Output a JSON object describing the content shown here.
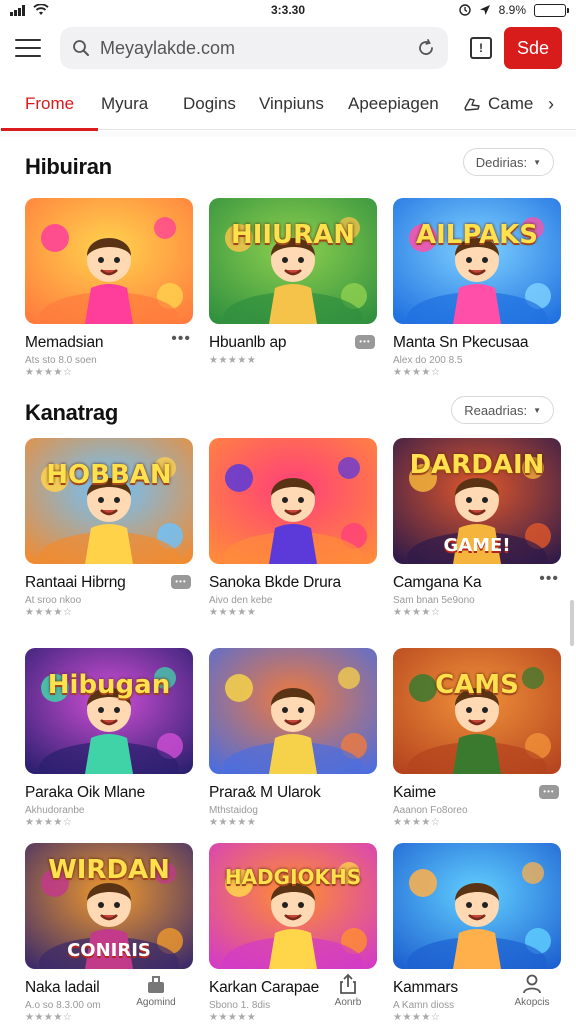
{
  "status_bar": {
    "time": "3:3.30",
    "battery": "8.9%",
    "battery_level": 0.85
  },
  "toolbar": {
    "search_value": "Meyaylakde.com",
    "action_label": "Sde"
  },
  "tabs": [
    {
      "label": "Frome",
      "active": true
    },
    {
      "label": "Myura"
    },
    {
      "label": "Dogins"
    },
    {
      "label": "Vinpiuns"
    },
    {
      "label": "Apeepiagen"
    },
    {
      "label": "Came",
      "icon": "controller-icon"
    }
  ],
  "sections": [
    {
      "title": "Hibuiran",
      "filter": "Dedirias:",
      "apps": [
        {
          "name": "Memadsian",
          "sub": "Ats sto 8.0 soen",
          "stars": "★★★★☆",
          "badge": "more"
        },
        {
          "name": "Hbuanlb ap",
          "sub": "",
          "stars": "★★★★★",
          "badge": "chat",
          "banner": "HIIURAN"
        },
        {
          "name": "Manta Sn Pkecusaa",
          "sub": "Alex do 200 8.5",
          "stars": "★★★★☆",
          "badge": "none",
          "banner": "AILPAKS"
        }
      ]
    },
    {
      "title": "Kanatrag",
      "filter": "Reaadrias:",
      "apps": [
        {
          "name": "Rantaai Hibrng",
          "sub": "At sroo nkoo",
          "stars": "★★★★☆",
          "badge": "chat",
          "banner": "HOBBAN"
        },
        {
          "name": "Sanoka Bkde Drura",
          "sub": "Aivo den kebe",
          "stars": "★★★★★",
          "badge": "none"
        },
        {
          "name": "Camgana Ka",
          "sub": "Sam bnan 5e9ono",
          "stars": "★★★★☆",
          "badge": "more",
          "banner": "DARDAIN",
          "banner2": "GAME!"
        }
      ]
    },
    {
      "title": "",
      "filter": "",
      "apps": [
        {
          "name": "Paraka Oik Mlane",
          "sub": "Akhudoranbe",
          "stars": "★★★★☆",
          "badge": "none",
          "banner": "Hibugan"
        },
        {
          "name": "Prara& M Ularok",
          "sub": "Mthstaidog",
          "stars": "★★★★★",
          "badge": "none"
        },
        {
          "name": "Kaime",
          "sub": "Aaanon Fo8oreo",
          "stars": "★★★★☆",
          "badge": "chat",
          "banner": "CAMS"
        }
      ]
    },
    {
      "title": "",
      "filter": "",
      "apps": [
        {
          "name": "Naka ladail",
          "sub": "A.o so 8.3.00 om",
          "stars": "★★★★☆",
          "badge": "none",
          "banner": "WIRDAN",
          "banner2": "CONIRIS"
        },
        {
          "name": "Karkan Carapae",
          "sub": "Sbono 1. 8dis",
          "stars": "★★★★★",
          "badge": "none",
          "banner": "HADGIOKHS"
        },
        {
          "name": "Kammars",
          "sub": "A Kamn dioss",
          "stars": "★★★★☆",
          "badge": "none"
        }
      ]
    }
  ],
  "bottom_nav": [
    {
      "label": "Agomind",
      "icon": "tray-icon"
    },
    {
      "label": "Aonrb",
      "icon": "share-icon"
    },
    {
      "label": "Akopcis",
      "icon": "person-icon"
    }
  ],
  "colors": {
    "accent": "#d81b1b",
    "text": "#1a1a1a",
    "muted": "#999999"
  }
}
